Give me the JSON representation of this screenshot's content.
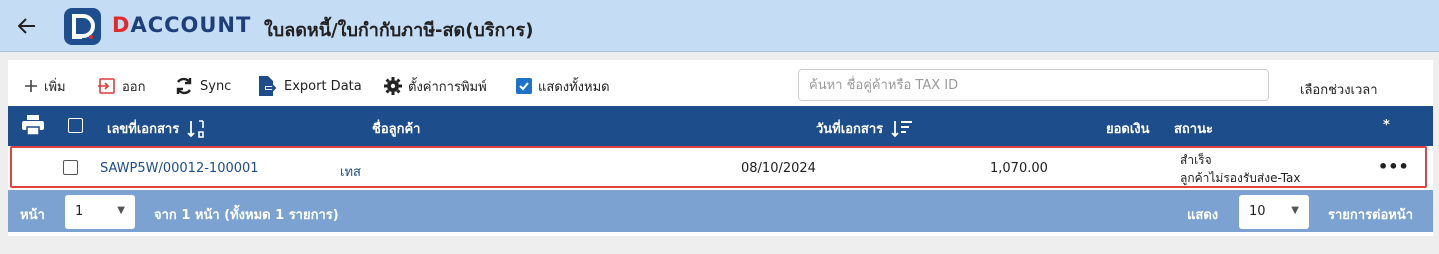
{
  "header": {
    "back_icon": "arrow-left-icon",
    "brand": "DACCOUNT",
    "brand_first": "D",
    "brand_rest": "ACCOUNT",
    "title": "ใบลดหนี้/ใบกำกับภาษี-สด(บริการ)"
  },
  "toolbar": {
    "add_label": "เพิ่ม",
    "exit_label": "ออก",
    "sync_label": "Sync",
    "export_label": "Export Data",
    "print_settings_label": "ตั้งค่าการพิมพ์",
    "show_all_label": "แสดงทั้งหมด",
    "show_all_checked": true,
    "search_placeholder": "ค้นหา ชื่อคู่ค้าหรือ TAX ID",
    "period_label": "เลือกช่วงเวลา"
  },
  "table": {
    "columns": {
      "doc_no": "เลขที่เอกสาร",
      "customer": "ชื่อลูกค้า",
      "doc_date": "วันที่เอกสาร",
      "amount": "ยอดเงิน",
      "status": "สถานะ",
      "actions": "*"
    },
    "rows": [
      {
        "doc_no": "SAWP5W/00012-100001",
        "customer": "เทส",
        "doc_date": "08/10/2024",
        "amount": "1,070.00",
        "status_line1": "สำเร็จ",
        "status_line2": "ลูกค้าไม่รองรับส่งe-Tax",
        "actions": "•••"
      }
    ]
  },
  "footer": {
    "page_label": "หน้า",
    "page_value": "1",
    "page_info": "จาก 1 หน้า (ทั้งหมด 1 รายการ)",
    "show_label": "แสดง",
    "per_page_value": "10",
    "per_page_suffix": "รายการต่อหน้า"
  },
  "colors": {
    "header_bg": "#c4dcf4",
    "table_header": "#1e4d8c",
    "footer_bg": "#7ba2d1",
    "highlight": "#e04343",
    "brand_red": "#e02b2b"
  }
}
